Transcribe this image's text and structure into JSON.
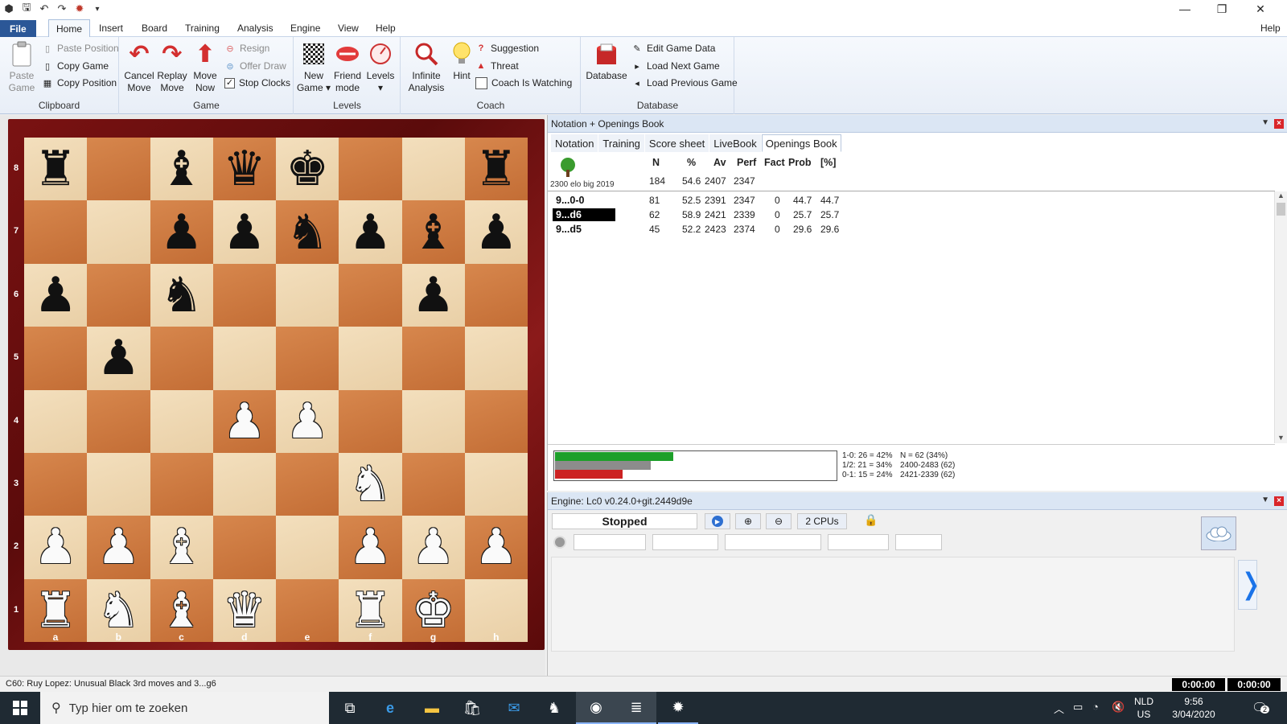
{
  "titlebar": {
    "help": "Help"
  },
  "menu": {
    "file": "File",
    "tabs": [
      "Home",
      "Insert",
      "Board",
      "Training",
      "Analysis",
      "Engine",
      "View",
      "Help"
    ],
    "help_right": "Help"
  },
  "ribbon": {
    "clipboard": {
      "label": "Clipboard",
      "paste_game": [
        "Paste",
        "Game"
      ],
      "paste_position": "Paste Position",
      "copy_game": "Copy Game",
      "copy_position": "Copy Position"
    },
    "game": {
      "label": "Game",
      "cancel_move": [
        "Cancel",
        "Move"
      ],
      "replay_move": [
        "Replay",
        "Move"
      ],
      "move_now": [
        "Move",
        "Now"
      ],
      "resign": "Resign",
      "offer_draw": "Offer Draw",
      "stop_clocks": "Stop Clocks"
    },
    "levels": {
      "label": "Levels",
      "new_game": [
        "New",
        "Game"
      ],
      "friend_mode": [
        "Friend",
        "mode"
      ],
      "levels": "Levels"
    },
    "coach": {
      "label": "Coach",
      "infinite_analysis": [
        "Infinite",
        "Analysis"
      ],
      "hint": "Hint",
      "suggestion": "Suggestion",
      "threat": "Threat",
      "coach_is_watching": "Coach Is Watching"
    },
    "database": {
      "label": "Database",
      "database": "Database",
      "edit_game_data": "Edit Game Data",
      "load_next_game": "Load Next Game",
      "load_previous_game": "Load Previous Game"
    }
  },
  "board": {
    "ranks": [
      "8",
      "7",
      "6",
      "5",
      "4",
      "3",
      "2",
      "1"
    ],
    "files": [
      "a",
      "b",
      "c",
      "d",
      "e",
      "f",
      "g",
      "h"
    ],
    "position": [
      [
        "r",
        "",
        "b",
        "q",
        "k",
        "",
        "",
        "r"
      ],
      [
        "",
        "",
        "p",
        "p",
        "n",
        "p",
        "b",
        "p"
      ],
      [
        "p",
        "",
        "n",
        "",
        "",
        "",
        "p",
        ""
      ],
      [
        "",
        "p",
        "",
        "",
        "",
        "",
        "",
        ""
      ],
      [
        "",
        "",
        "",
        "P",
        "P",
        "",
        "",
        ""
      ],
      [
        "",
        "",
        "",
        "",
        "",
        "N",
        "",
        ""
      ],
      [
        "P",
        "P",
        "B",
        "",
        "",
        "P",
        "P",
        "P"
      ],
      [
        "R",
        "N",
        "B",
        "Q",
        "",
        "R",
        "K",
        ""
      ]
    ]
  },
  "notation_panel": {
    "title": "Notation + Openings Book",
    "tabs": [
      "Notation",
      "Training",
      "Score sheet",
      "LiveBook",
      "Openings Book"
    ],
    "active_tab": "Openings Book",
    "book_name": "2300 elo big 2019",
    "headers": [
      "N",
      "%",
      "Av",
      "Perf",
      "Fact",
      "Prob",
      "[%]"
    ],
    "totals": {
      "n": "184",
      "pct": "54.6",
      "av": "2407",
      "perf": "2347"
    },
    "moves": [
      {
        "move": "9...0-0",
        "n": "81",
        "pct": "52.5",
        "av": "2391",
        "perf": "2347",
        "fact": "0",
        "prob": "44.7",
        "share": "44.7"
      },
      {
        "move": "9...d6",
        "n": "62",
        "pct": "58.9",
        "av": "2421",
        "perf": "2339",
        "fact": "0",
        "prob": "25.7",
        "share": "25.7"
      },
      {
        "move": "9...d5",
        "n": "45",
        "pct": "52.2",
        "av": "2423",
        "perf": "2374",
        "fact": "0",
        "prob": "29.6",
        "share": "29.6"
      }
    ],
    "stats": {
      "win": "1-0: 26 = 42%",
      "draw": "1/2: 21 = 34%",
      "loss": "0-1: 15 = 24%",
      "n_line": "N = 62 (34%)",
      "range1": "2400-2483 (62)",
      "range2": "2421-2339 (62)",
      "win_frac": 0.42,
      "draw_frac": 0.34,
      "loss_frac": 0.24
    }
  },
  "engine_panel": {
    "title": "Engine: Lc0 v0.24.0+git.2449d9e",
    "status": "Stopped",
    "cpus": "2 CPUs"
  },
  "statusbar": {
    "opening": "C60: Ruy Lopez: Unusual Black 3rd moves and 3...g6",
    "clock_white": "0:00:00",
    "clock_black": "0:00:00"
  },
  "taskbar": {
    "search_placeholder": "Typ hier om te zoeken",
    "lang": "NLD",
    "layout": "US",
    "time": "9:56",
    "date": "3/04/2020",
    "notif_count": "2"
  },
  "colors": {
    "file_tab": "#2b5797",
    "board_light": "#f0d9b5",
    "board_dark": "#c87339",
    "frame": "#7a1212",
    "selected_move": "#000000",
    "stat_win": "#1d9f2a",
    "stat_draw": "#8c8c8c",
    "stat_loss": "#cc2222"
  }
}
